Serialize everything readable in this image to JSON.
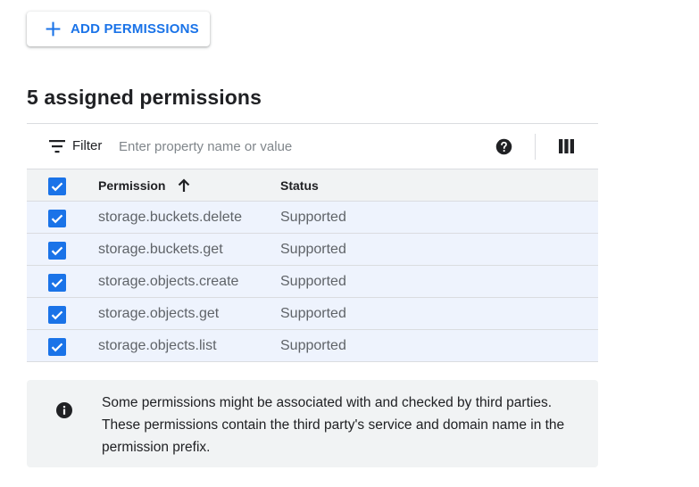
{
  "toolbar": {
    "add_label": "ADD PERMISSIONS"
  },
  "title": "5 assigned permissions",
  "filter": {
    "label": "Filter",
    "placeholder": "Enter property name or value"
  },
  "table": {
    "columns": {
      "permission": "Permission",
      "status": "Status"
    },
    "sort": "ascending",
    "rows": [
      {
        "permission": "storage.buckets.delete",
        "status": "Supported",
        "checked": true
      },
      {
        "permission": "storage.buckets.get",
        "status": "Supported",
        "checked": true
      },
      {
        "permission": "storage.objects.create",
        "status": "Supported",
        "checked": true
      },
      {
        "permission": "storage.objects.get",
        "status": "Supported",
        "checked": true
      },
      {
        "permission": "storage.objects.list",
        "status": "Supported",
        "checked": true
      }
    ]
  },
  "notice": {
    "icon": "info-icon",
    "text": "Some permissions might be associated with and checked by third parties. These permissions contain the third party's service and domain name in the permission prefix."
  },
  "colors": {
    "accent": "#1a73e8",
    "row_selected": "#eef3fd",
    "header_bg": "#f1f3f4"
  }
}
